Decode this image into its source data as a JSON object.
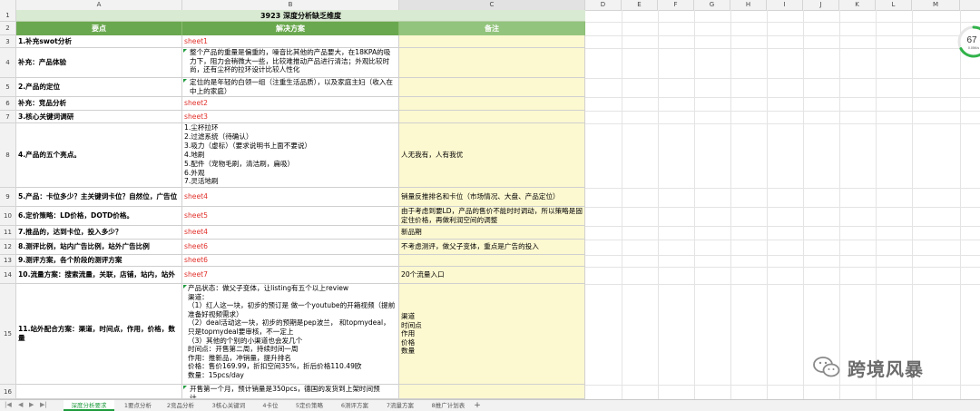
{
  "columns": {
    "letters": [
      "A",
      "B",
      "C",
      "D",
      "E",
      "F",
      "G",
      "H",
      "I",
      "J",
      "K",
      "L",
      "M"
    ]
  },
  "sheet": {
    "title": "3923 深度分析缺乏维度",
    "headers": {
      "a": "要点",
      "b": "解决方案",
      "c": "备注"
    },
    "rows": [
      {
        "num": "3",
        "a": "1.补充swot分析",
        "b": "sheet1",
        "b_red": true,
        "c": ""
      },
      {
        "num": "4",
        "a": "补充：产品体验",
        "b": "整个产品的重量是偏重的，噪音比其他的产品要大，在18KPA的吸力下，阻力会稍微大一些，比较难推动产品进行清洁；外观比较时尚，还有尘杯的拉环设计比较人性化",
        "b_red": false,
        "c": ""
      },
      {
        "num": "5",
        "a": "2.产品的定位",
        "b": "定位的是年轻的白领一组（注重生活品质），以及家庭主妇（收入在中上的家庭）",
        "b_red": false,
        "c": ""
      },
      {
        "num": "6",
        "a": "补充：竞品分析",
        "b": "sheet2",
        "b_red": true,
        "c": ""
      },
      {
        "num": "7",
        "a": "3.核心关键词调研",
        "b": "sheet3",
        "b_red": true,
        "c": ""
      },
      {
        "num": "8",
        "a": "4.产品的五个亮点。",
        "b": "1.尘杯拉环\n2.过滤系统（待确认）\n3.吸力（虚标）（要求说明书上面不要说）\n4.地刷\n5.配件（宠物毛刷，清洁刷，扁吸）\n6.外观\n7.灵活地刷",
        "b_red": false,
        "c": "人无我有，人有我优"
      },
      {
        "num": "9",
        "a": "5.产品：卡位多少？主关键词卡位？自然位，广告位",
        "b": "sheet4",
        "b_red": true,
        "c": "销量反推排名和卡位（市场情况、大盘、产品定位）"
      },
      {
        "num": "10",
        "a": "6.定价策略：LD价格，DOTD价格。",
        "b": "sheet5",
        "b_red": true,
        "c": "由于考虑到要LD，产品的售价不能时时调动，所以策略是固定住价格，再做利润空间的调整"
      },
      {
        "num": "11",
        "a": "7.推品的，达到卡位，投入多少？",
        "b": "sheet4",
        "b_red": true,
        "c": "新品期"
      },
      {
        "num": "12",
        "a": "8.测评比例，站内广告比例，站外广告比例",
        "b": "sheet6",
        "b_red": true,
        "c": "不考虑测评，做父子变体，重点是广告的投入"
      },
      {
        "num": "13",
        "a": "9.测评方案，各个阶段的测评方案",
        "b": "sheet6",
        "b_red": true,
        "c": ""
      },
      {
        "num": "14",
        "a": "10.流量方案：搜索流量，关联，店铺，站内，站外",
        "b": "sheet7",
        "b_red": true,
        "c": "20个流量入口"
      },
      {
        "num": "15",
        "a": "11.站外配合方案：渠道，时间点，作用，价格，数量",
        "b": "产品状态：做父子变体，让listing有五个以上review\n渠道：\n（1）红人这一块，初步的预订是 做一个youtube的开箱视频（提前准备好视频需求）\n（2）deal活动这一块，初步的预期是pep波兰， 和topmydeal，只是topmydeal要审核，不一定上\n（3）其他的个别的小渠道也会发几个\n时间点：开售第二周，持续时间一周\n作用：推新品，冲销量，提升排名\n价格：售价169.99，折扣空间35%，折后价格110.49欧\n数量：15pcs/day",
        "b_red": false,
        "c": "渠道\n时间点\n作用\n价格\n数量"
      },
      {
        "num": "16",
        "a": "",
        "b": "开售第一个月，预计销量是350pcs，德国的发货到上架时间预计……",
        "b_red": false,
        "c": ""
      }
    ]
  },
  "tabs": {
    "nav": [
      "|◀",
      "◀",
      "▶",
      "▶|"
    ],
    "items": [
      "深度分析要求",
      "1要点分析",
      "2竞品分析",
      "3核心关键词",
      "4卡位",
      "5定价策略",
      "6测评方案",
      "7流量方案",
      "8推广计划表",
      "+"
    ],
    "active_index": 0
  },
  "gauge": {
    "percent_label": "67",
    "unit": "%",
    "sub": "0.05K/s",
    "fraction": 0.67,
    "color": "#31b34a"
  },
  "watermark": {
    "text": "跨境风暴",
    "icon": "wechat-icon"
  }
}
